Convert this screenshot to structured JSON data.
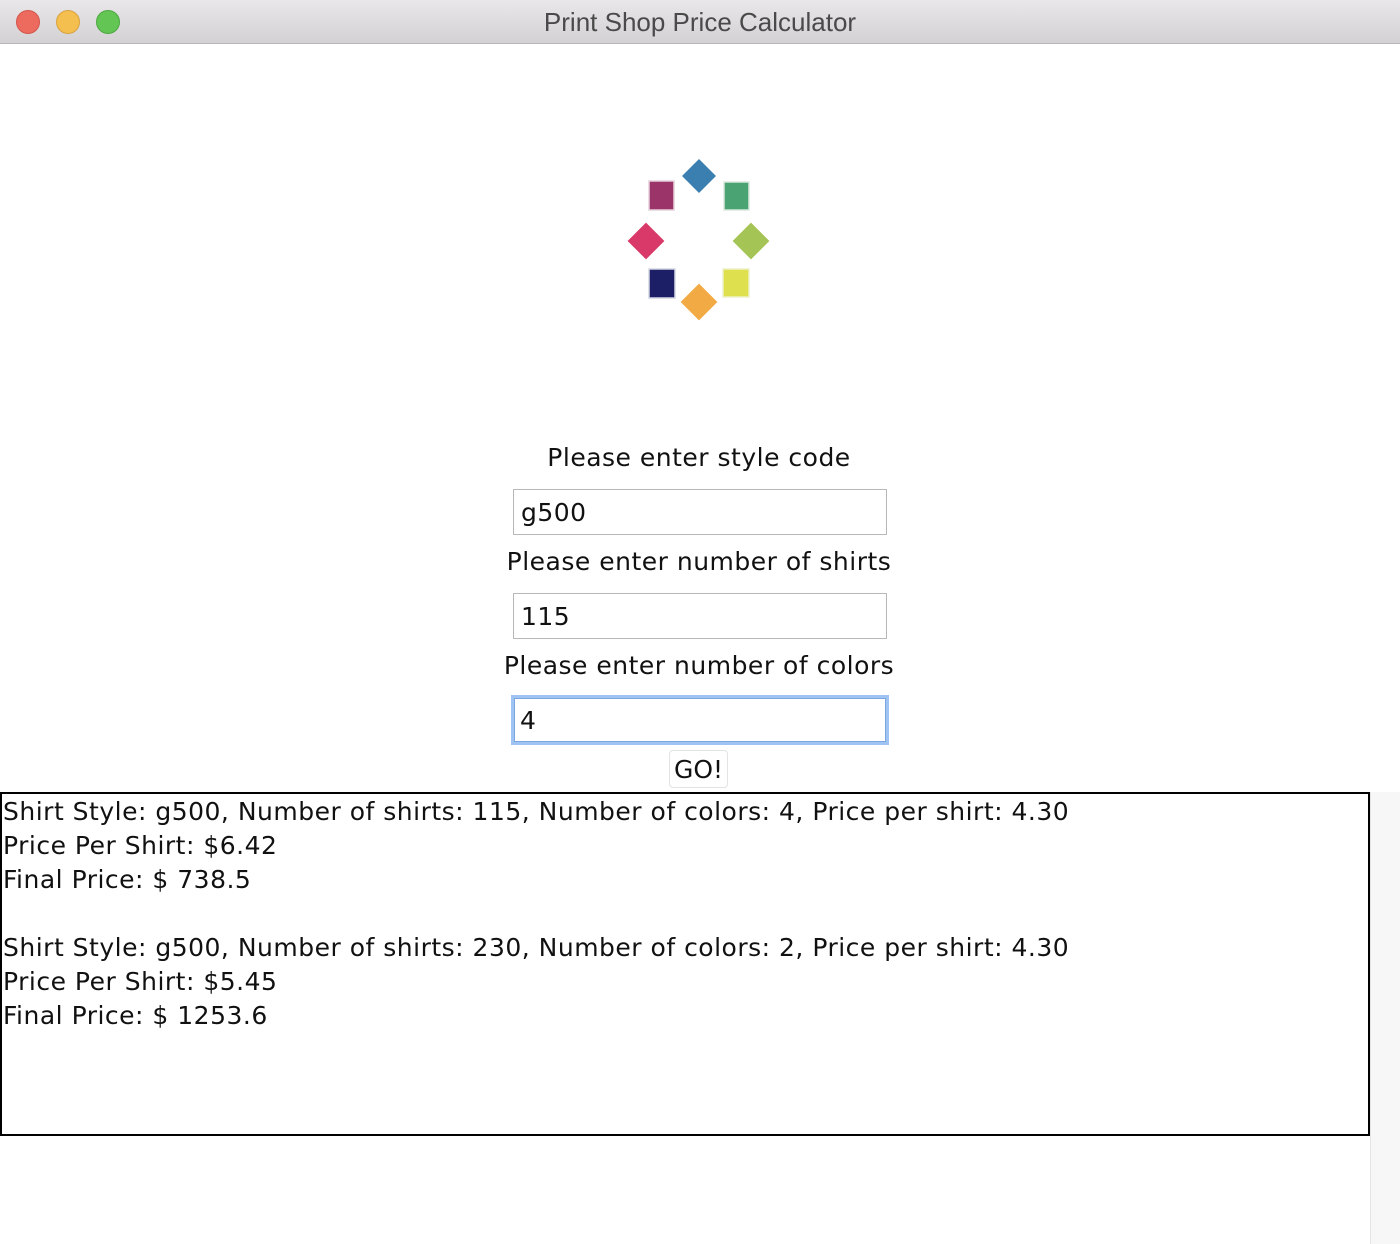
{
  "window": {
    "title": "Print Shop Price Calculator"
  },
  "logo": {
    "name": "print-shop-logo",
    "colors": [
      "#3a7fb0",
      "#4aa372",
      "#a5c456",
      "#dfe04e",
      "#f2aa45",
      "#1c1f66",
      "#d83968",
      "#9b3469"
    ]
  },
  "form": {
    "style_label": "Please enter style code",
    "style_value": "g500",
    "shirts_label": "Please enter number of shirts",
    "shirts_value": "115",
    "colors_label": "Please enter number of colors",
    "colors_value": "4",
    "go_label": "GO!"
  },
  "output": {
    "lines": [
      "Shirt Style: g500, Number of shirts: 115, Number of colors: 4, Price per shirt: 4.30",
      "Price Per Shirt: $6.42",
      "Final Price: $ 738.5",
      "",
      "Shirt Style: g500, Number of shirts: 230, Number of colors: 2, Price per shirt: 4.30",
      "Price Per Shirt: $5.45",
      "Final Price: $ 1253.6"
    ]
  }
}
